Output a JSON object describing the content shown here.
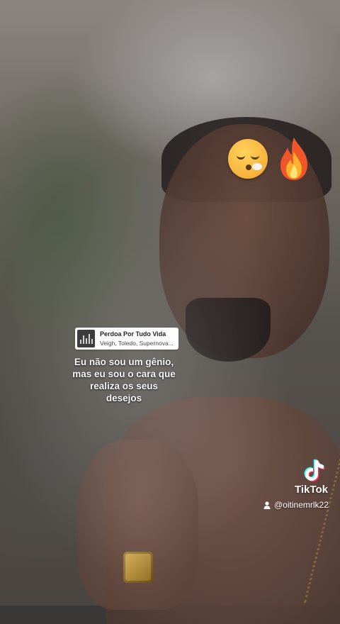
{
  "music": {
    "title": "Perdoa Por Tudo Vida",
    "artist": "Veigh, Toledo, Supernova..."
  },
  "caption": {
    "line1": "Eu não sou um gênio,",
    "line2": "mas eu sou o cara que",
    "line3": "realiza os seus",
    "line4": "desejos"
  },
  "watermark": {
    "brand": "TikTok",
    "username": "@oitinemrlk22"
  },
  "stickers": [
    "face-exhaling-emoji",
    "fire-emoji"
  ],
  "colors": {
    "tiktok_cyan": "#25F4EE",
    "tiktok_red": "#FE2C55"
  }
}
